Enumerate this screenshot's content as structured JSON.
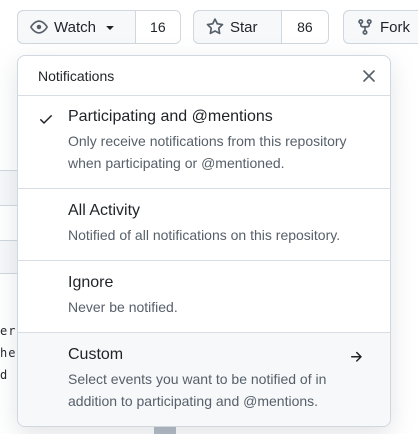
{
  "toolbar": {
    "watch": {
      "label": "Watch",
      "count": "16"
    },
    "star": {
      "label": "Star",
      "count": "86"
    },
    "fork": {
      "label": "Fork"
    }
  },
  "background": {
    "lines": [
      "er",
      "he",
      "d b"
    ]
  },
  "notifications_menu": {
    "title": "Notifications",
    "items": [
      {
        "title": "Participating and @mentions",
        "description": "Only receive notifications from this repository when participating or @mentioned.",
        "selected": true
      },
      {
        "title": "All Activity",
        "description": "Notified of all notifications on this repository.",
        "selected": false
      },
      {
        "title": "Ignore",
        "description": "Never be notified.",
        "selected": false
      },
      {
        "title": "Custom",
        "description": "Select events you want to be notified of in addition to participating and @mentions.",
        "selected": false
      }
    ]
  },
  "colors": {
    "border": "#d0d7de",
    "muted_text": "#57606a",
    "button_bg": "#f6f8fa"
  }
}
